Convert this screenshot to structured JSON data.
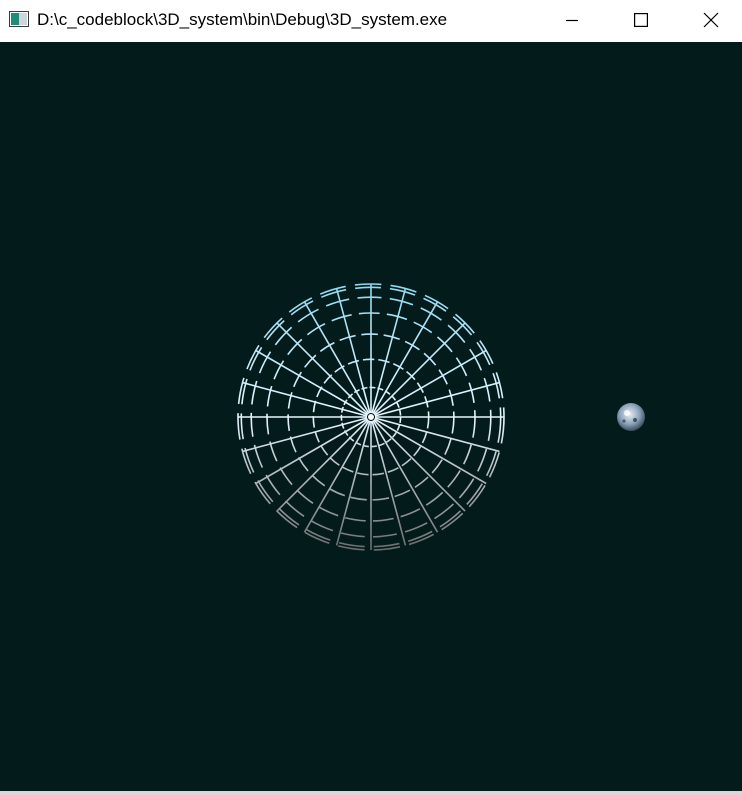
{
  "window": {
    "title": "D:\\c_codeblock\\3D_system\\bin\\Debug\\3D_system.exe",
    "icon": "console-app-icon",
    "controls": {
      "minimize_icon": "minimize-icon",
      "maximize_icon": "maximize-icon",
      "close_icon": "close-icon"
    }
  },
  "scene": {
    "background_color": "#031b1b",
    "main_sphere": {
      "wireframe": true,
      "meridians": 24,
      "latitude_rings": 7,
      "top_color": "#8fd8f0",
      "mid_color": "#e8f6ff",
      "bottom_color": "#6a6a6a"
    },
    "small_sphere": {
      "colors": [
        "#e8eef4",
        "#8aa2b8",
        "#3c4c5c"
      ]
    }
  }
}
